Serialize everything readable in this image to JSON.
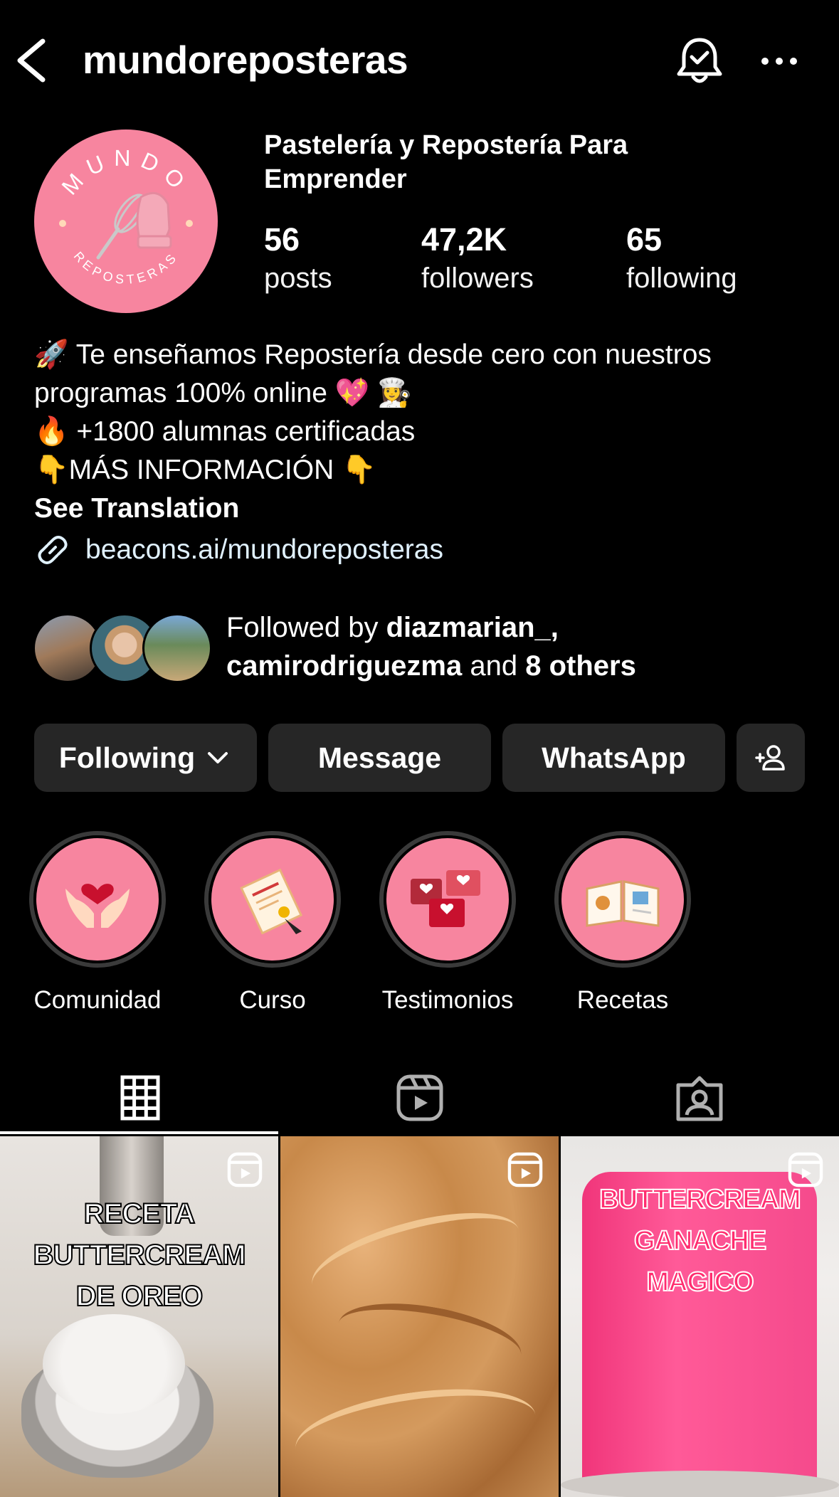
{
  "header": {
    "username": "mundoreposteras",
    "back_icon": "chevron-left-icon",
    "bell_icon": "bell-check-icon",
    "more_icon": "more-horizontal-icon"
  },
  "profile": {
    "avatar_top_text": "MUNDO",
    "avatar_bottom_text": "REPOSTERAS",
    "display_name": "Pastelería y Repostería Para Emprender",
    "stats": [
      {
        "value": "56",
        "label": "posts"
      },
      {
        "value": "47,2K",
        "label": "followers"
      },
      {
        "value": "65",
        "label": "following"
      }
    ]
  },
  "bio": {
    "line1": "Te enseñamos Repostería desde cero con nuestros",
    "line2": "programas 100% online",
    "line3": "+1800 alumnas certificadas",
    "line4": "MÁS INFORMACIÓN",
    "see_translation": "See Translation",
    "link": "beacons.ai/mundoreposteras"
  },
  "followed_by": {
    "prefix": "Followed by",
    "user1": "diazmarian_,",
    "user2": "camirodriguezma",
    "mid": "and",
    "others": "8 others"
  },
  "buttons": {
    "following": "Following",
    "message": "Message",
    "whatsapp": "WhatsApp"
  },
  "highlights": [
    {
      "label": "Comunidad"
    },
    {
      "label": "Curso"
    },
    {
      "label": "Testimonios"
    },
    {
      "label": "Recetas"
    }
  ],
  "tabs": [
    "grid-icon",
    "reels-icon",
    "tagged-icon"
  ],
  "posts": [
    {
      "text": [
        "RECETA",
        "BUTTERCREAM",
        "DE OREO"
      ]
    },
    {
      "text": []
    },
    {
      "text": [
        "BUTTERCREAM",
        "GANACHE",
        "MAGICO"
      ]
    }
  ],
  "colors": {
    "brand_pink": "#f7859f",
    "button_bg": "#262626",
    "background": "#000000"
  }
}
